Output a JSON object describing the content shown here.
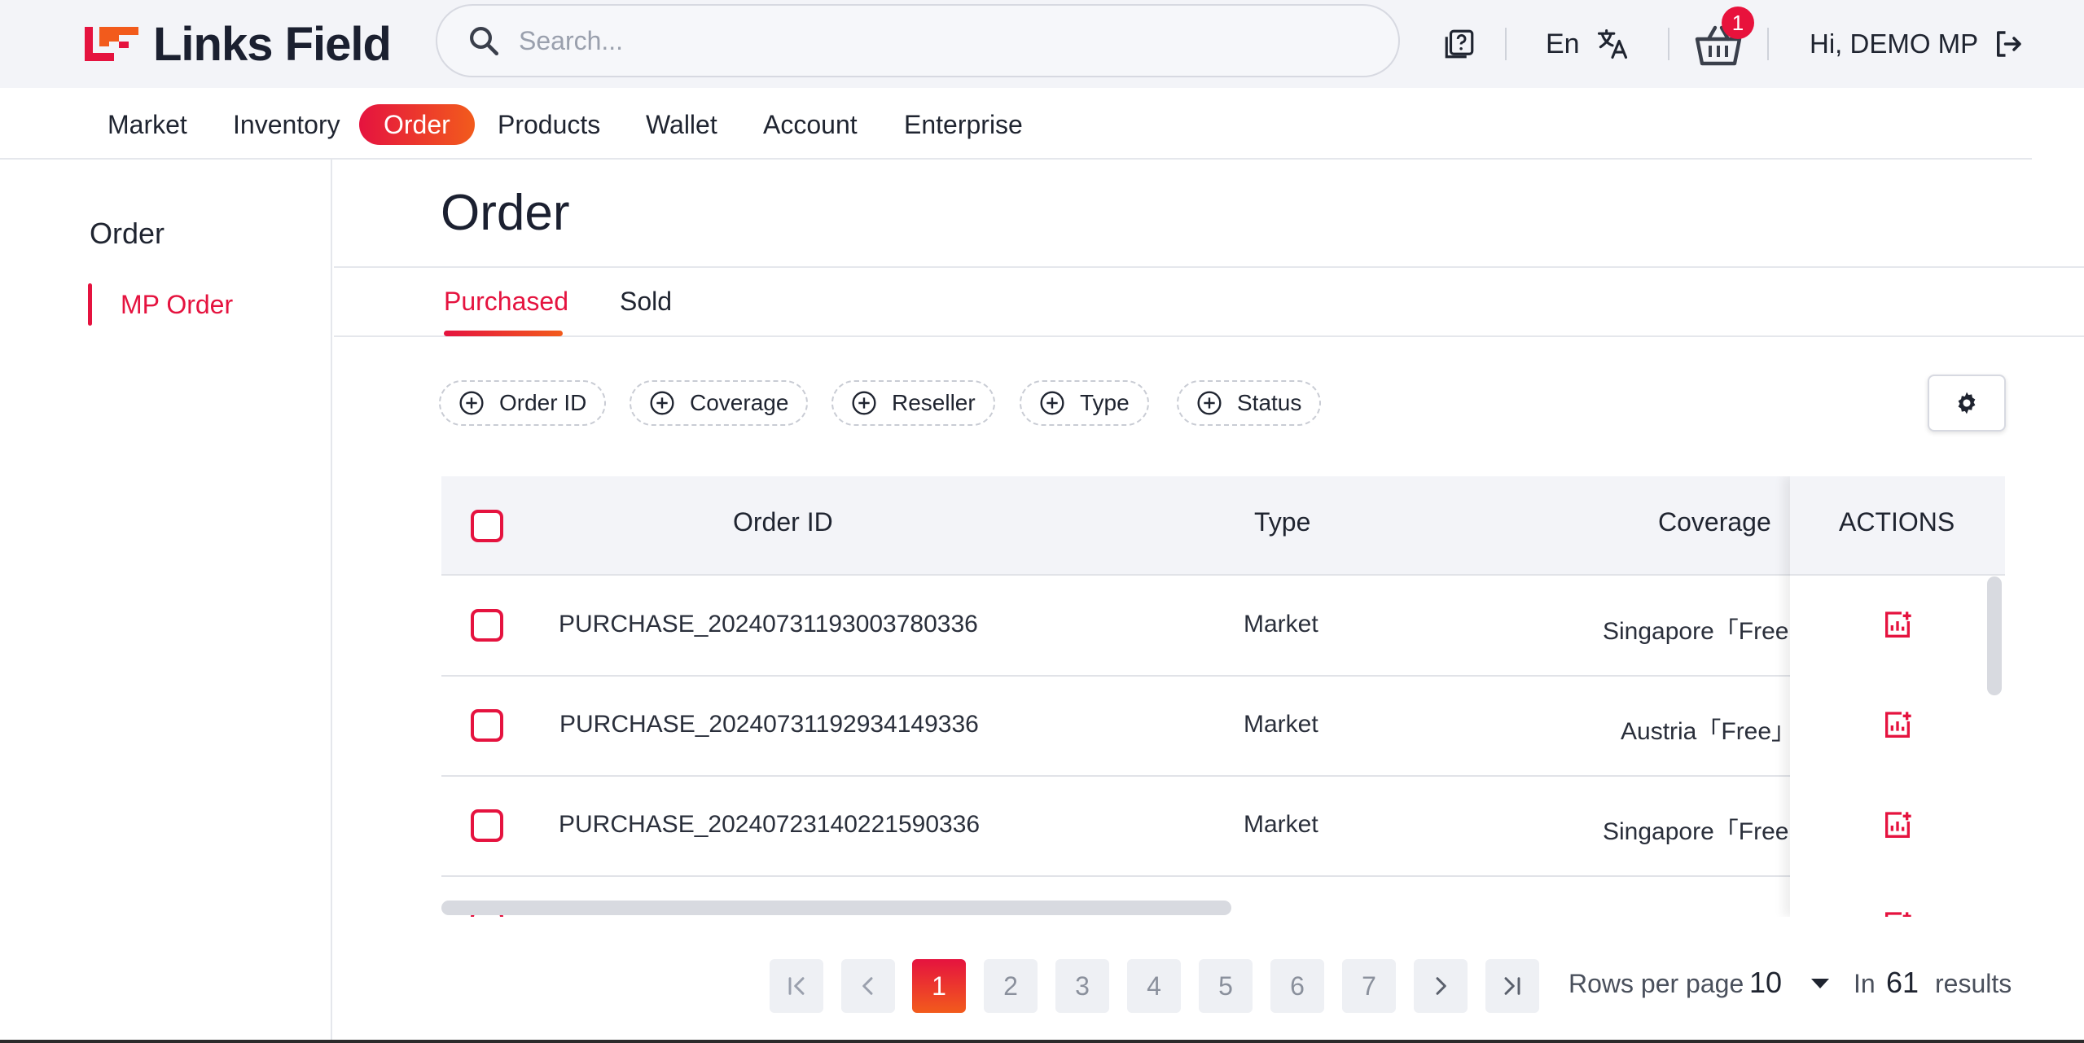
{
  "app": {
    "name": "Links Field"
  },
  "search": {
    "placeholder": "Search..."
  },
  "header": {
    "language": "En",
    "cart_count": "1",
    "greeting": "Hi, DEMO MP"
  },
  "nav": {
    "items": [
      "Market",
      "Inventory",
      "Order",
      "Products",
      "Wallet",
      "Account",
      "Enterprise"
    ],
    "active": "Order"
  },
  "sidebar": {
    "title": "Order",
    "items": [
      {
        "label": "MP Order",
        "active": true
      }
    ]
  },
  "page": {
    "title": "Order"
  },
  "tabs": [
    {
      "label": "Purchased",
      "active": true
    },
    {
      "label": "Sold",
      "active": false
    }
  ],
  "filters": [
    "Order ID",
    "Coverage",
    "Reseller",
    "Type",
    "Status"
  ],
  "table": {
    "columns": [
      "Order ID",
      "Type",
      "Coverage",
      "ACTIONS"
    ],
    "rows": [
      {
        "order_id": "PURCHASE_20240731193003780336",
        "type": "Market",
        "coverage": "Singapore「Free"
      },
      {
        "order_id": "PURCHASE_20240731192934149336",
        "type": "Market",
        "coverage": "Austria「Free」"
      },
      {
        "order_id": "PURCHASE_20240723140221590336",
        "type": "Market",
        "coverage": "Singapore「Free"
      }
    ]
  },
  "pagination": {
    "pages": [
      "1",
      "2",
      "3",
      "4",
      "5",
      "6",
      "7"
    ],
    "current": "1",
    "rows_per_page_label": "Rows per page",
    "rows_per_page": "10",
    "in_label": "In",
    "total": "61",
    "results_label": "results"
  },
  "colors": {
    "accent": "#e5133f",
    "accent_gradient_end": "#f25b1c",
    "background": "#f3f4f8"
  }
}
